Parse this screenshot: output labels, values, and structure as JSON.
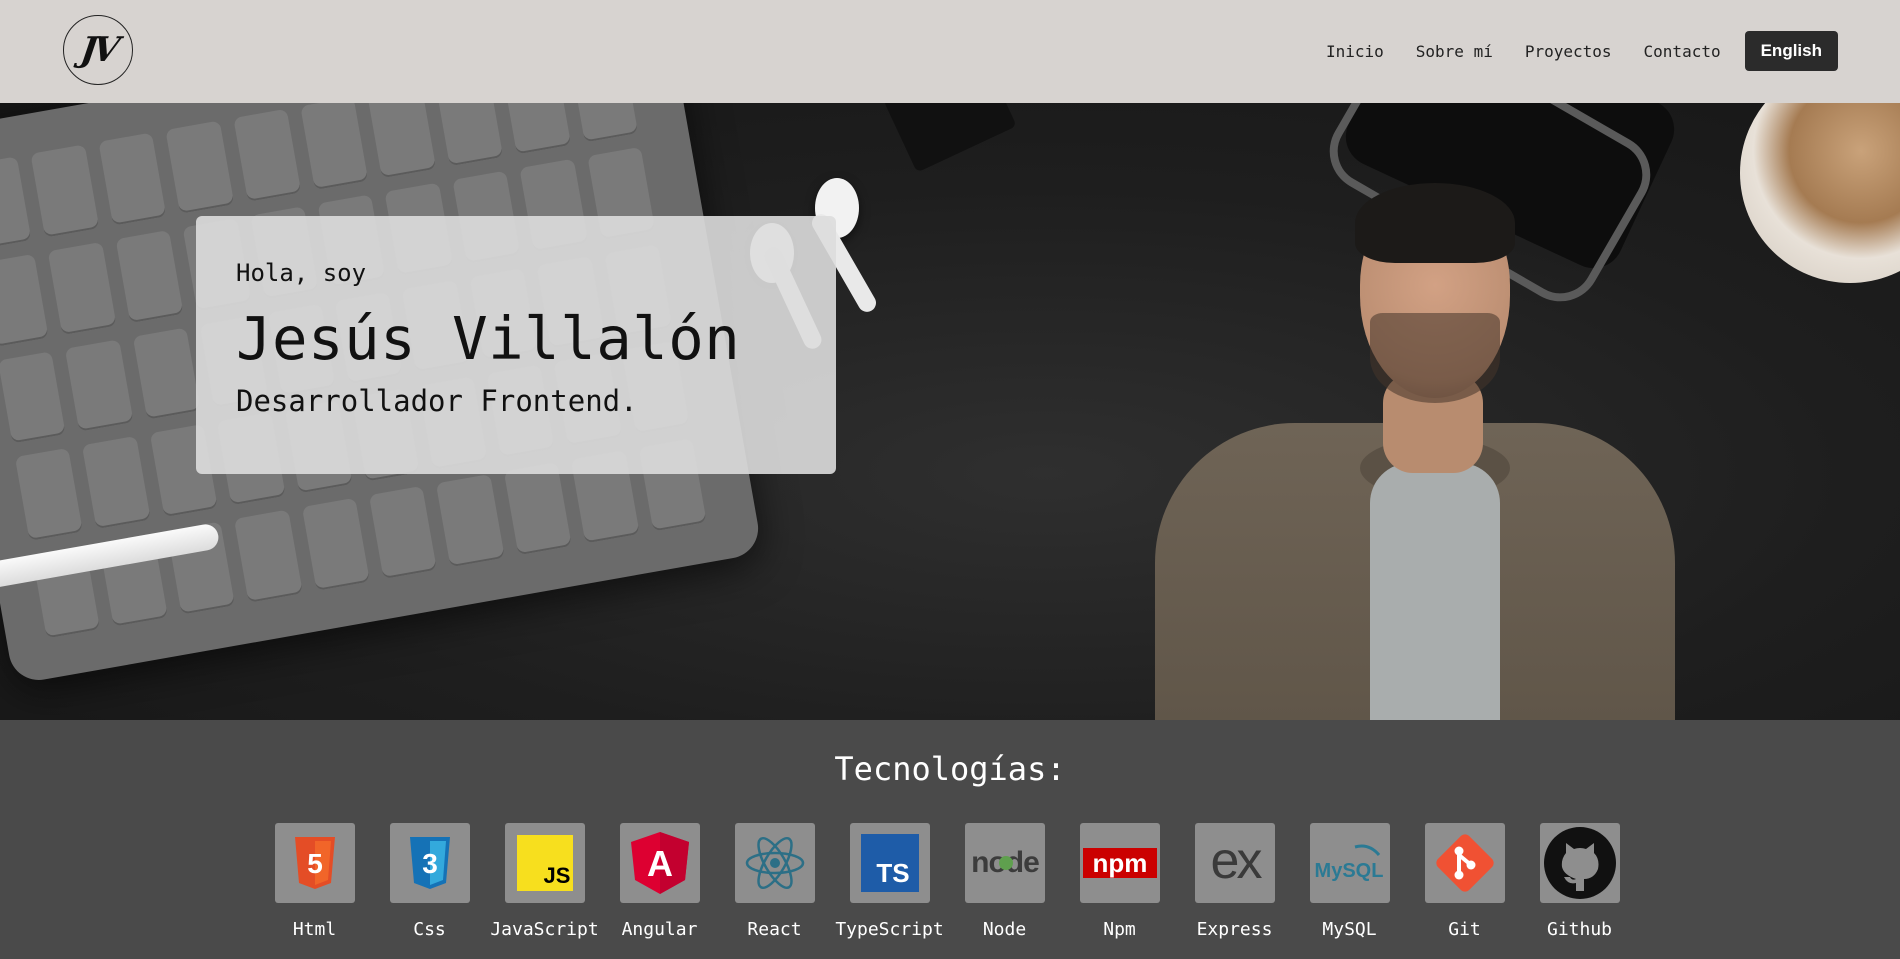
{
  "header": {
    "logo_text": "JV",
    "nav": [
      "Inicio",
      "Sobre mí",
      "Proyectos",
      "Contacto"
    ],
    "language_button": "English"
  },
  "hero": {
    "greeting": "Hola, soy",
    "name": "Jesús Villalón",
    "role": "Desarrollador Frontend."
  },
  "technologies": {
    "title": "Tecnologías:",
    "items": [
      {
        "label": "Html",
        "icon": "html5-icon"
      },
      {
        "label": "Css",
        "icon": "css3-icon"
      },
      {
        "label": "JavaScript",
        "icon": "javascript-icon"
      },
      {
        "label": "Angular",
        "icon": "angular-icon"
      },
      {
        "label": "React",
        "icon": "react-icon"
      },
      {
        "label": "TypeScript",
        "icon": "typescript-icon"
      },
      {
        "label": "Node",
        "icon": "node-icon"
      },
      {
        "label": "Npm",
        "icon": "npm-icon"
      },
      {
        "label": "Express",
        "icon": "express-icon"
      },
      {
        "label": "MySQL",
        "icon": "mysql-icon"
      },
      {
        "label": "Git",
        "icon": "git-icon"
      },
      {
        "label": "Github",
        "icon": "github-icon"
      }
    ],
    "icon_glyphs": {
      "html5": "5",
      "css3": "3",
      "javascript": "JS",
      "angular": "A",
      "typescript": "TS",
      "node": "node",
      "npm": "npm",
      "express": "ex",
      "mysql": "MySQL"
    }
  },
  "colors": {
    "header_bg": "#d7d3d0",
    "tech_bg": "#4a4a4a",
    "button_bg": "#2b2b2b"
  }
}
